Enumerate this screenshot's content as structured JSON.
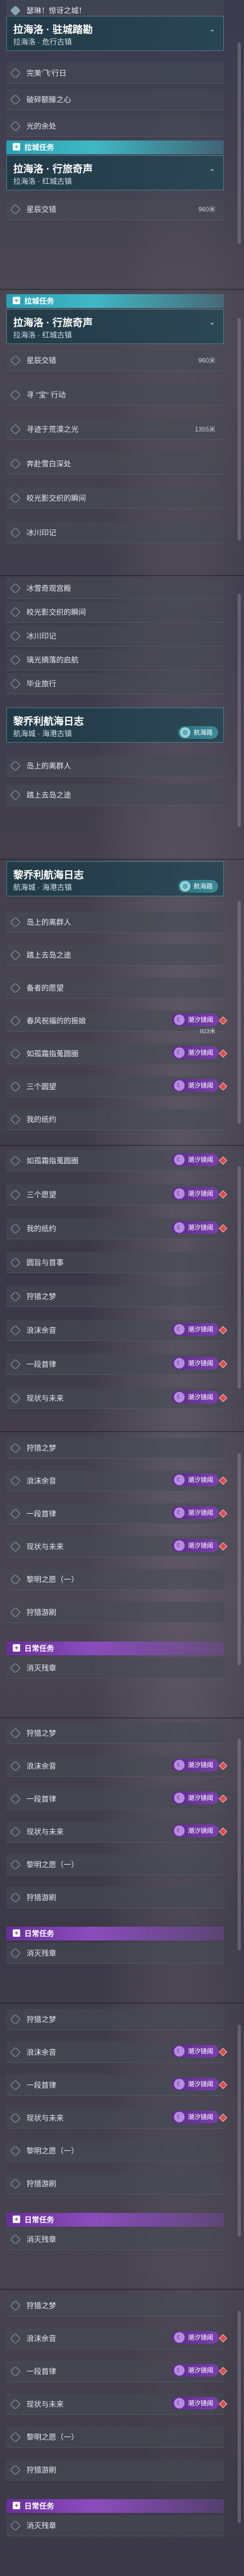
{
  "colors": {
    "accent_cyan": "#2aa0b4",
    "accent_purple": "#6a2f9a",
    "alert_red": "#e04a4a"
  },
  "icons": {
    "row_marker": "diamond-outline-icon",
    "chevron": "chevron-up-icon",
    "category": "quest-category-icon",
    "tag_moon": "moon-icon",
    "tag_nav": "compass-icon"
  },
  "s1": {
    "rows": [
      {
        "label": "瑟琳！惊讶之城！"
      }
    ],
    "header": {
      "title": "拉海洛 · 驻城踏勘",
      "sub": "拉海洛 · 危行古镇"
    },
    "rows2": [
      {
        "label": "完美'飞'行日"
      },
      {
        "label": "破碎额滕之心"
      },
      {
        "label": "光的余处"
      }
    ],
    "cat": "拉城任务",
    "header2": {
      "title": "拉海洛 · 行旅奇声",
      "sub": "拉海洛 · 红城古镇"
    },
    "rows3": [
      {
        "label": "星辰交错",
        "dist": "960米"
      }
    ]
  },
  "s2": {
    "cat": "拉城任务",
    "header": {
      "title": "拉海洛 · 行旅奇声",
      "sub": "拉海洛 · 红城古镇"
    },
    "rows": [
      {
        "label": "星辰交错",
        "dist": "960米"
      },
      {
        "label": "寻 \"宝\" 行动",
        "dist": ""
      },
      {
        "label": "寻迹于荒漠之光",
        "dist": "1355米"
      },
      {
        "label": "奔赴雪白深处",
        "dist": ""
      },
      {
        "label": "皎光影交织的瞬间",
        "dist": ""
      },
      {
        "label": "冰川印记",
        "dist": ""
      }
    ]
  },
  "s3": {
    "rows": [
      {
        "label": "冰雪奇观宫殿"
      },
      {
        "label": "皎光影交织的瞬间"
      },
      {
        "label": "冰川印记"
      },
      {
        "label": "璃光摘落的启航"
      },
      {
        "label": "毕业旅行"
      }
    ],
    "header": {
      "title": "黎乔利航海日志",
      "sub": "航海城 · 海港古镇"
    },
    "nav_tag": "航海路",
    "rows2": [
      {
        "label": "岛上的离群人"
      },
      {
        "label": "踏上去岛之途"
      }
    ]
  },
  "s4": {
    "header": {
      "title": "黎乔利航海日志",
      "sub": "航海城 · 海港古镇"
    },
    "nav_tag": "航海路",
    "rows": [
      {
        "label": "岛上的离群人",
        "tag": "",
        "dist": ""
      },
      {
        "label": "踏上去岛之途",
        "tag": "",
        "dist": ""
      },
      {
        "label": "备者的愿望",
        "tag": "",
        "dist": ""
      },
      {
        "label": "春风祝福的的振娘",
        "tag": "潮汐镜阈",
        "dist": "923米"
      },
      {
        "label": "如孤霜指蒐圆圈",
        "tag": "潮汐镜阈",
        "dist": ""
      },
      {
        "label": "三个圆望",
        "tag": "潮汐镜阈",
        "dist": ""
      },
      {
        "label": "我的纸约",
        "tag": "",
        "dist": ""
      }
    ]
  },
  "s5": {
    "rows": [
      {
        "label": "如孤霜指蒐圆圈",
        "tag": "潮汐镜阈"
      },
      {
        "label": "三个愿望",
        "tag": "潮汐镜阈"
      },
      {
        "label": "我的纸约",
        "tag": "潮汐镜阈"
      },
      {
        "label": "圆旨与首事",
        "tag": ""
      },
      {
        "label": "狩猎之梦",
        "tag": ""
      },
      {
        "label": "浪沫余音",
        "tag": "潮汐镜阈"
      },
      {
        "label": "一段首律",
        "tag": "潮汐镜阈"
      },
      {
        "label": "现状与未来",
        "tag": "潮汐镜阈"
      }
    ]
  },
  "s6": {
    "rows": [
      {
        "label": "狩猎之梦",
        "tag": ""
      },
      {
        "label": "浪沫余音",
        "tag": "潮汐镜阈"
      },
      {
        "label": "一段首律",
        "tag": "潮汐镜阈"
      },
      {
        "label": "现状与未来",
        "tag": "潮汐镜阈"
      },
      {
        "label": "黎明之愿（一）",
        "tag": ""
      },
      {
        "label": "狩猎游刷",
        "tag": ""
      }
    ],
    "cat": "日常任务",
    "daily": "消灭残章"
  },
  "s7": {
    "rows": [
      {
        "label": "狩猎之梦",
        "tag": ""
      },
      {
        "label": "浪沫余音",
        "tag": "潮汐镜阈"
      },
      {
        "label": "一段首律",
        "tag": "潮汐镜阈"
      },
      {
        "label": "现状与未来",
        "tag": "潮汐镜阈"
      },
      {
        "label": "黎明之愿（一）",
        "tag": ""
      },
      {
        "label": "狩猎游刷",
        "tag": ""
      }
    ],
    "cat": "日常任务",
    "daily": "消灭残章"
  },
  "s8": {
    "rows": [
      {
        "label": "狩猎之梦",
        "tag": ""
      },
      {
        "label": "浪沫余音",
        "tag": "潮汐镜阈"
      },
      {
        "label": "一段首律",
        "tag": "潮汐镜阈"
      },
      {
        "label": "现状与未来",
        "tag": "潮汐镜阈"
      },
      {
        "label": "黎明之愿（一）",
        "tag": ""
      },
      {
        "label": "狩猎游刷",
        "tag": ""
      }
    ],
    "cat": "日常任务",
    "daily": "消灭残章"
  },
  "s9": {
    "rows": [
      {
        "label": "狩猎之梦",
        "tag": ""
      },
      {
        "label": "浪沫余音",
        "tag": "潮汐镜阈"
      },
      {
        "label": "一段首律",
        "tag": "潮汐镜阈"
      },
      {
        "label": "现状与未来",
        "tag": "潮汐镜阈"
      },
      {
        "label": "黎明之愿（一）",
        "tag": ""
      },
      {
        "label": "狩猎游刷",
        "tag": ""
      }
    ],
    "cat": "日常任务",
    "daily": "消灭残章"
  }
}
